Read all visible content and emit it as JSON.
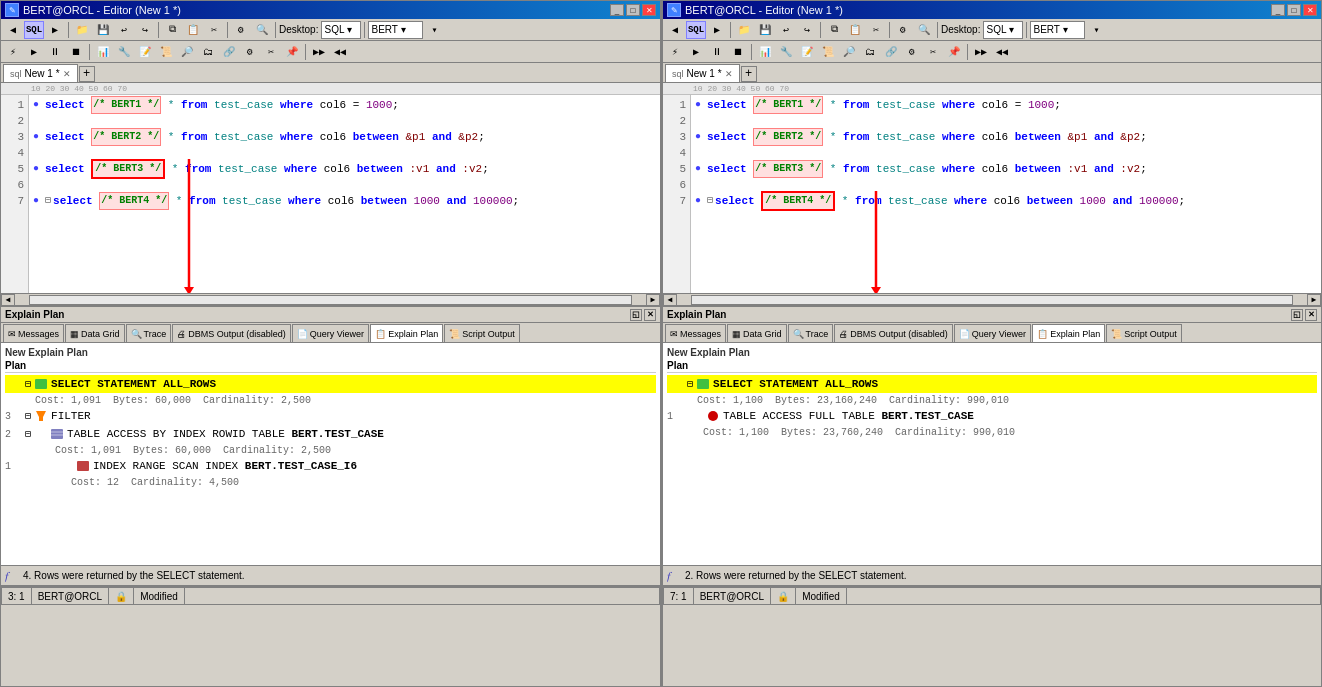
{
  "panels": [
    {
      "title": "BERT@ORCL - Editor (New 1 *)",
      "tab_label": "New 1 *",
      "desktop_label": "Desktop:",
      "desktop_value": "SQL",
      "connection": "BERT",
      "ruler_marks": "        10        20        30        40        50        60        70",
      "lines": [
        {
          "num": 1,
          "bullet": "●",
          "content": "select",
          "hint": "/* BERT1 */",
          "rest": " * from test_case where col6 = 1000;",
          "type": "query1"
        },
        {
          "num": 2,
          "bullet": "",
          "content": "",
          "hint": "",
          "rest": "",
          "type": "blank"
        },
        {
          "num": 3,
          "bullet": "●",
          "content": "select",
          "hint": "/* BERT2 */",
          "rest": " * from test_case where col6 between &p1 and &p2;",
          "type": "query2"
        },
        {
          "num": 4,
          "bullet": "",
          "content": "",
          "hint": "",
          "rest": "",
          "type": "blank"
        },
        {
          "num": 5,
          "bullet": "●",
          "content": "select",
          "hint": "/* BERT3 */",
          "rest": " * from test_case where col6 between :v1 and :v2;",
          "type": "query3"
        },
        {
          "num": 6,
          "bullet": "",
          "content": "",
          "hint": "",
          "rest": "",
          "type": "blank"
        },
        {
          "num": 7,
          "bullet": "●",
          "expand": "⊟",
          "content": "select",
          "hint": "/* BERT4 */",
          "rest": " * from test_case where col6 between 1000 and 100000;",
          "type": "query4_active"
        }
      ],
      "explain_plan": {
        "title": "Explain Plan",
        "new_label": "New Explain Plan",
        "plan_col": "Plan",
        "rows": [
          {
            "indent": 0,
            "num": "",
            "expand": "⊟",
            "icon": "select",
            "text": "SELECT STATEMENT ALL_ROWS",
            "highlight": true,
            "sub": "Cost: 1,091  Bytes: 60,000  Cardinality: 2,500"
          },
          {
            "indent": 1,
            "num": "3",
            "expand": "⊟",
            "icon": "filter",
            "text": "FILTER",
            "highlight": false,
            "sub": null
          },
          {
            "indent": 2,
            "num": "2",
            "expand": "⊟",
            "icon": "table",
            "text": "TABLE ACCESS BY INDEX ROWID TABLE BERT.TEST_CASE",
            "highlight": false,
            "sub": "Cost: 1,091  Bytes: 60,000  Cardinality: 2,500"
          },
          {
            "indent": 3,
            "num": "1",
            "expand": "",
            "icon": "index",
            "text": "INDEX RANGE SCAN INDEX BERT.TEST_CASE_I6",
            "highlight": false,
            "sub": "Cost: 12  Cardinality: 4,500"
          }
        ],
        "bottom_msg": "4. Rows were returned by the SELECT statement."
      },
      "status": {
        "pos": "3: 1",
        "connection": "BERT@ORCL",
        "lock": "",
        "modified": "Modified"
      },
      "tabs": [
        {
          "label": "Messages",
          "icon": "msg"
        },
        {
          "label": "Data Grid",
          "icon": "grid"
        },
        {
          "label": "Trace",
          "icon": "trace"
        },
        {
          "label": "DBMS Output (disabled)",
          "icon": "dbms"
        },
        {
          "label": "Query Viewer",
          "icon": "qv"
        },
        {
          "label": "Explain Plan",
          "icon": "ep",
          "active": true
        },
        {
          "label": "Script Output",
          "icon": "so"
        }
      ],
      "hint_boxed": "/* BERT3 */"
    },
    {
      "title": "BERT@ORCL - Editor (New 1 *)",
      "tab_label": "New 1 *",
      "desktop_label": "Desktop:",
      "desktop_value": "SQL",
      "connection": "BERT",
      "ruler_marks": "        10        20        30        40        50        60        70",
      "lines": [
        {
          "num": 1,
          "bullet": "●",
          "content": "select",
          "hint": "/* BERT1 */",
          "rest": " * from test_case where col6 = 1000;",
          "type": "query1"
        },
        {
          "num": 2,
          "bullet": "",
          "content": "",
          "hint": "",
          "rest": "",
          "type": "blank"
        },
        {
          "num": 3,
          "bullet": "●",
          "content": "select",
          "hint": "/* BERT2 */",
          "rest": " * from test_case where col6 between &p1 and &p2;",
          "type": "query2"
        },
        {
          "num": 4,
          "bullet": "",
          "content": "",
          "hint": "",
          "rest": "",
          "type": "blank"
        },
        {
          "num": 5,
          "bullet": "●",
          "content": "select",
          "hint": "/* BERT3 */",
          "rest": " * from test_case where col6 between :v1 and :v2;",
          "type": "query3"
        },
        {
          "num": 6,
          "bullet": "",
          "content": "",
          "hint": "",
          "rest": "",
          "type": "blank"
        },
        {
          "num": 7,
          "bullet": "●",
          "expand": "⊟",
          "content": "select",
          "hint": "/* BERT4 */",
          "rest": " * from test_case where col6 between 1000 and 100000;",
          "type": "query4_active"
        }
      ],
      "explain_plan": {
        "title": "Explain Plan",
        "new_label": "New Explain Plan",
        "plan_col": "Plan",
        "rows": [
          {
            "indent": 0,
            "num": "",
            "expand": "⊟",
            "icon": "select",
            "text": "SELECT STATEMENT ALL_ROWS",
            "highlight": true,
            "sub": "Cost: 1,100  Bytes: 23,760,240  Cardinality: 990,010"
          },
          {
            "indent": 1,
            "num": "1",
            "expand": "",
            "icon": "full",
            "text": "TABLE ACCESS FULL TABLE BERT.TEST_CASE",
            "highlight": false,
            "sub": "Cost: 1,100  Bytes: 23,760,240  Cardinality: 990,010"
          }
        ],
        "bottom_msg": "2. Rows were returned by the SELECT statement."
      },
      "status": {
        "pos": "7: 1",
        "connection": "BERT@ORCL",
        "lock": "",
        "modified": "Modified"
      },
      "tabs": [
        {
          "label": "Messages",
          "icon": "msg"
        },
        {
          "label": "Data Grid",
          "icon": "grid"
        },
        {
          "label": "Trace",
          "icon": "trace"
        },
        {
          "label": "DBMS Output (disabled)",
          "icon": "dbms"
        },
        {
          "label": "Query Viewer",
          "icon": "qv"
        },
        {
          "label": "Explain Plan",
          "icon": "ep",
          "active": true
        },
        {
          "label": "Script Output",
          "icon": "so"
        }
      ],
      "hint_boxed": "/* BERT4 */"
    }
  ]
}
